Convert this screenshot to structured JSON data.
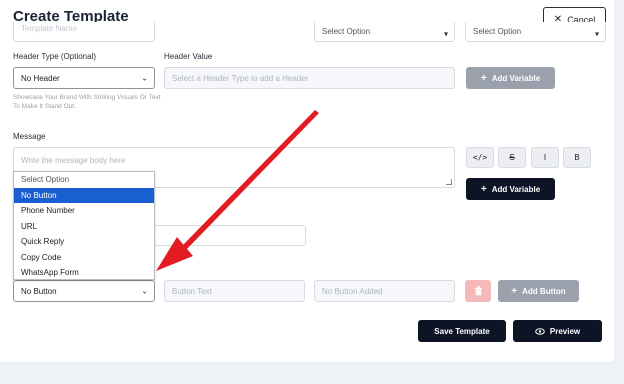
{
  "header": {
    "title": "Create Template",
    "cancel_label": "Cancel"
  },
  "top_row": {
    "template_name_placeholder": "Template Name",
    "select1": "Select Option",
    "select2": "Select Option"
  },
  "header_section": {
    "type_label": "Header Type (Optional)",
    "value_label": "Header Value",
    "type_value": "No Header",
    "value_placeholder": "Select a Header Type to add a Header",
    "add_variable_label": "Add Variable",
    "hint_line1": "Showcase Your Brand With Striking Visuals Or Text",
    "hint_line2": "To Make It Stand Out."
  },
  "message_section": {
    "label": "Message",
    "placeholder": "Write the message body here",
    "format_buttons": [
      "</>",
      "S",
      "I",
      "B"
    ],
    "add_variable_label": "Add Variable"
  },
  "buttons_section": {
    "dropdown_options": [
      "Select Option",
      "No Button",
      "Phone Number",
      "URL",
      "Quick Reply",
      "Copy Code",
      "WhatsApp Form"
    ],
    "selected_value": "No Button",
    "button_text_placeholder": "Button Text",
    "no_button_added": "No Button Added",
    "add_button_label": "Add Button"
  },
  "footer": {
    "save_label": "Save Template",
    "preview_label": "Preview"
  },
  "colors": {
    "primary_dark": "#0d1426",
    "highlight": "#1a5fd1",
    "disabled_grey": "#9aa1ad",
    "delete_pink": "#f6b9b9",
    "annotation_red": "#e31b23"
  }
}
